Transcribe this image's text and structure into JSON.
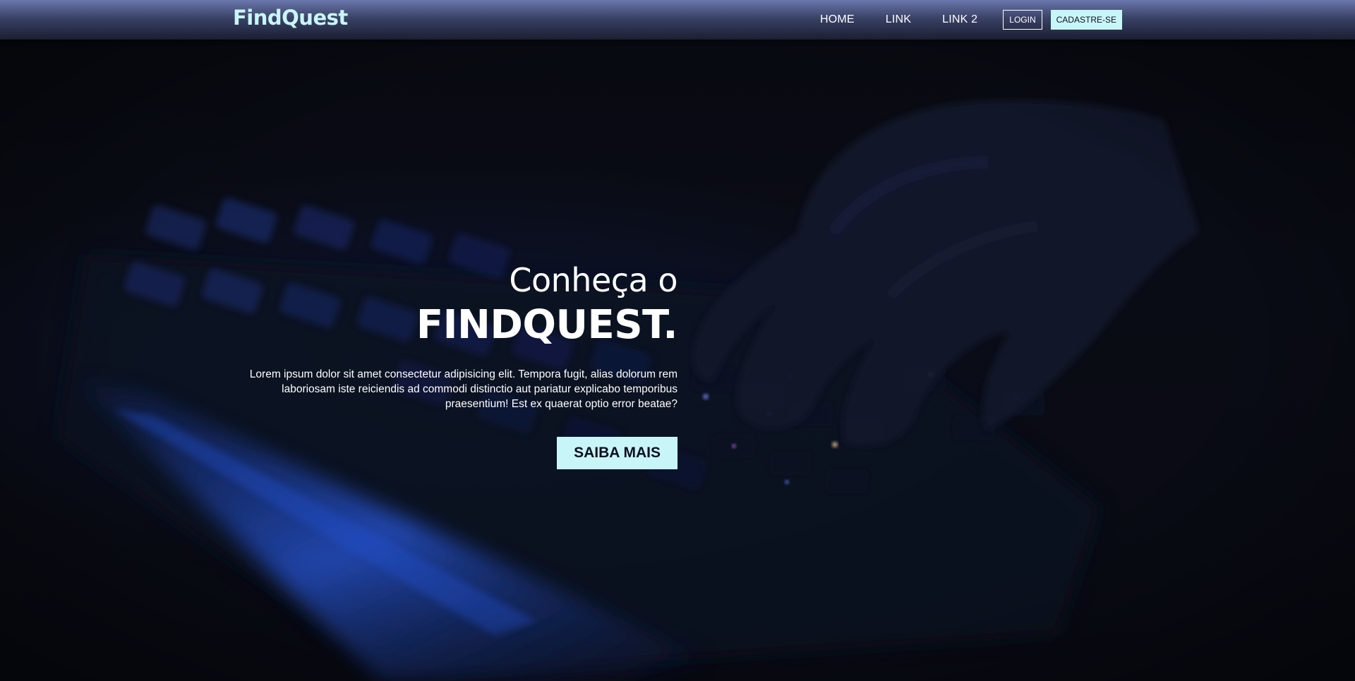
{
  "navbar": {
    "logo": "FindQuest",
    "links": [
      "HOME",
      "LINK",
      "LINK 2"
    ],
    "login_label": "LOGIN",
    "signup_label": "CADASTRE-SE"
  },
  "hero": {
    "subtitle": "Conheça o",
    "title": "FINDQUEST.",
    "text": "Lorem ipsum dolor sit amet consectetur adipisicing elit. Tempora fugit, alias dolorum rem laboriosam iste reiciendis ad commodi distinctio aut pariatur explicabo temporibus praesentium! Est ex quaerat optio error beatae?",
    "cta_label": "SAIBA MAIS",
    "background_image": "keyboard-hand-photo"
  },
  "colors": {
    "accent": "#c8f6f8",
    "navbar_top": "#6a77ad",
    "navbar_bottom": "#1b1f33",
    "background": "#0a0c13"
  }
}
